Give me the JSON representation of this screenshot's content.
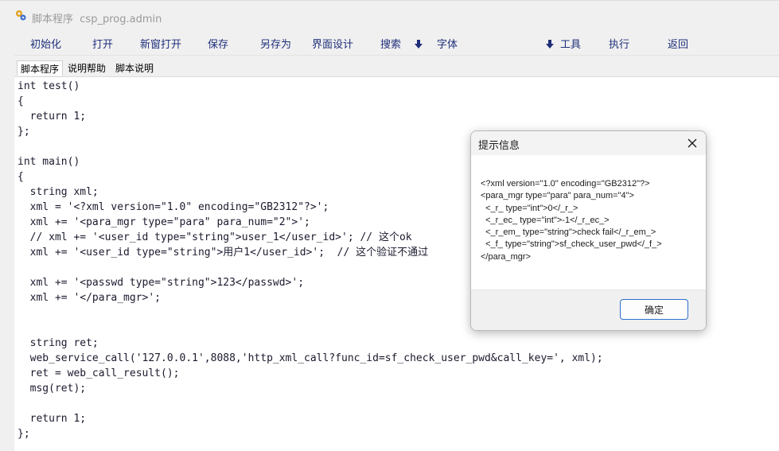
{
  "window": {
    "title": "脚本程序",
    "subtitle": "csp_prog.admin",
    "app_icon": "gear-app-icon"
  },
  "toolbar": {
    "init": "初始化",
    "open": "打开",
    "open_new_window": "新窗打开",
    "save": "保存",
    "save_as": "另存为",
    "ui_design": "界面设计",
    "search": "搜索",
    "font": "字体",
    "tools": "工具",
    "run": "执行",
    "back": "返回",
    "dropdown_icon": "down-arrow-icon",
    "accent_color": "#1f2f7a"
  },
  "tabs": {
    "script": "脚本程序",
    "help": "说明帮助",
    "description": "脚本说明"
  },
  "editor": {
    "code": "int test()\n{\n  return 1;\n};\n\nint main()\n{\n  string xml;\n  xml = '<?xml version=\"1.0\" encoding=\"GB2312\"?>';\n  xml += '<para_mgr type=\"para\" para_num=\"2\">';\n  // xml += '<user_id type=\"string\">user_1</user_id>'; // 这个ok\n  xml += '<user_id type=\"string\">用户1</user_id>';  // 这个验证不通过\n\n  xml += '<passwd type=\"string\">123</passwd>';\n  xml += '</para_mgr>';\n\n\n  string ret;\n  web_service_call('127.0.0.1',8088,'http_xml_call?func_id=sf_check_user_pwd&call_key=', xml);\n  ret = web_call_result();\n  msg(ret);\n\n  return 1;\n};"
  },
  "dialog": {
    "title": "提示信息",
    "message": "<?xml version=\"1.0\" encoding=\"GB2312\"?>\n<para_mgr type=\"para\" para_num=\"4\">\n  <_r_ type=\"int\">0</_r_>\n  <_r_ec_ type=\"int\">-1</_r_ec_>\n  <_r_em_ type=\"string\">check fail</_r_em_>\n  <_f_ type=\"string\">sf_check_user_pwd</_f_>\n</para_mgr>",
    "ok_label": "确定",
    "close_icon": "close-icon",
    "ok_border_color": "#2f6fd1"
  }
}
